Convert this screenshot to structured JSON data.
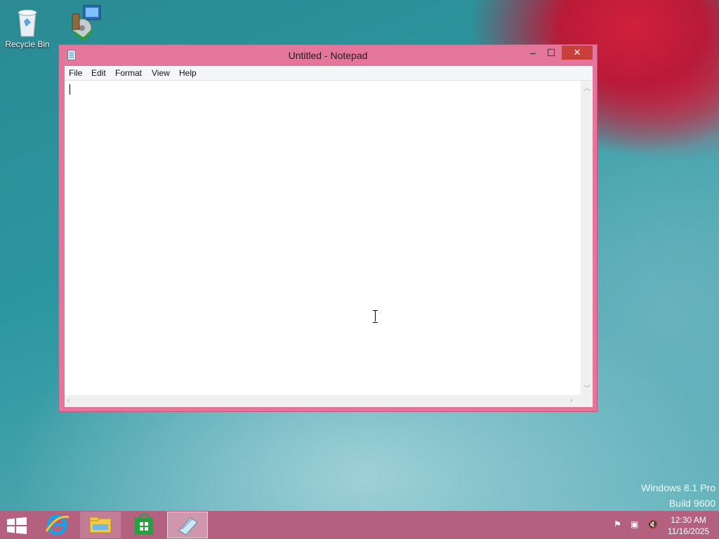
{
  "desktop": {
    "icons": [
      {
        "label": "Recycle Bin"
      },
      {
        "label": ""
      }
    ],
    "watermark": {
      "line1": "Windows 8.1 Pro",
      "line2": "Build 9600"
    }
  },
  "window": {
    "title": "Untitled - Notepad",
    "controls": {
      "minimize": "–",
      "maximize": "☐",
      "close": "✕"
    },
    "menu": [
      "File",
      "Edit",
      "Format",
      "View",
      "Help"
    ],
    "editor_text": ""
  },
  "taskbar": {
    "pinned": [
      "start-icon",
      "internet-explorer-icon",
      "file-explorer-icon",
      "store-icon",
      "notepad-icon"
    ],
    "tray": {
      "time": "12:30 AM",
      "date": "11/16/2025"
    }
  },
  "colors": {
    "window_frame": "#e4769c",
    "taskbar": "#b4607f",
    "close": "#c7403b"
  }
}
